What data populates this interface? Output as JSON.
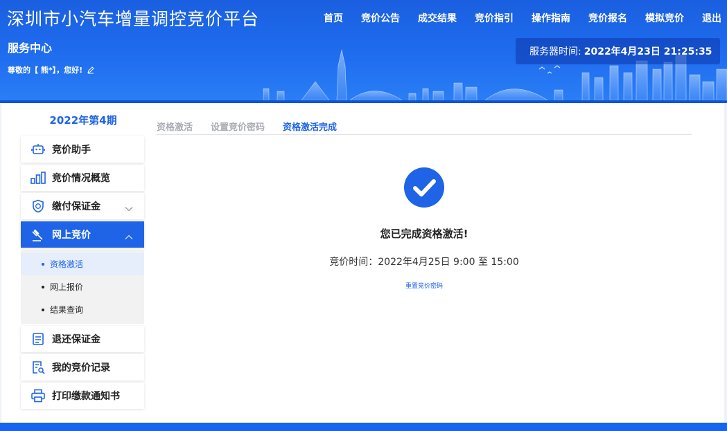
{
  "header": {
    "site_title": "深圳市小汽车增量调控竞价平台",
    "service_center": "服务中心",
    "greeting": "尊敬的【 熊*】，您好!",
    "server_time_label": "服务器时间:",
    "server_time_value": "2022年4月23日 21:25:35"
  },
  "nav": {
    "items": [
      "首页",
      "竞价公告",
      "成交结果",
      "竞价指引",
      "操作指南",
      "竞价报名",
      "模拟竞价",
      "退出"
    ]
  },
  "sidebar": {
    "period": "2022年第4期",
    "items": [
      {
        "label": "竞价助手",
        "icon": "robot-icon"
      },
      {
        "label": "竞价情况概览",
        "icon": "bar-chart-icon"
      },
      {
        "label": "缴付保证金",
        "icon": "shield-icon"
      },
      {
        "label": "网上竞价",
        "icon": "gavel-icon"
      },
      {
        "label": "退还保证金",
        "icon": "document-return-icon"
      },
      {
        "label": "我的竞价记录",
        "icon": "record-search-icon"
      },
      {
        "label": "打印缴款通知书",
        "icon": "printer-icon"
      }
    ],
    "subitems": [
      "资格激活",
      "网上报价",
      "结果查询"
    ]
  },
  "steps": [
    "资格激活",
    "设置竞价密码",
    "资格激活完成"
  ],
  "main": {
    "success_title": "您已完成资格激活!",
    "bid_time": "竞价时间：2022年4月25日 9:00 至 15:00",
    "reset_link": "重置竞价密码"
  },
  "colors": {
    "primary": "#1f64e6",
    "header": "#1f6df0",
    "step_inactive": "#a8acb3"
  }
}
